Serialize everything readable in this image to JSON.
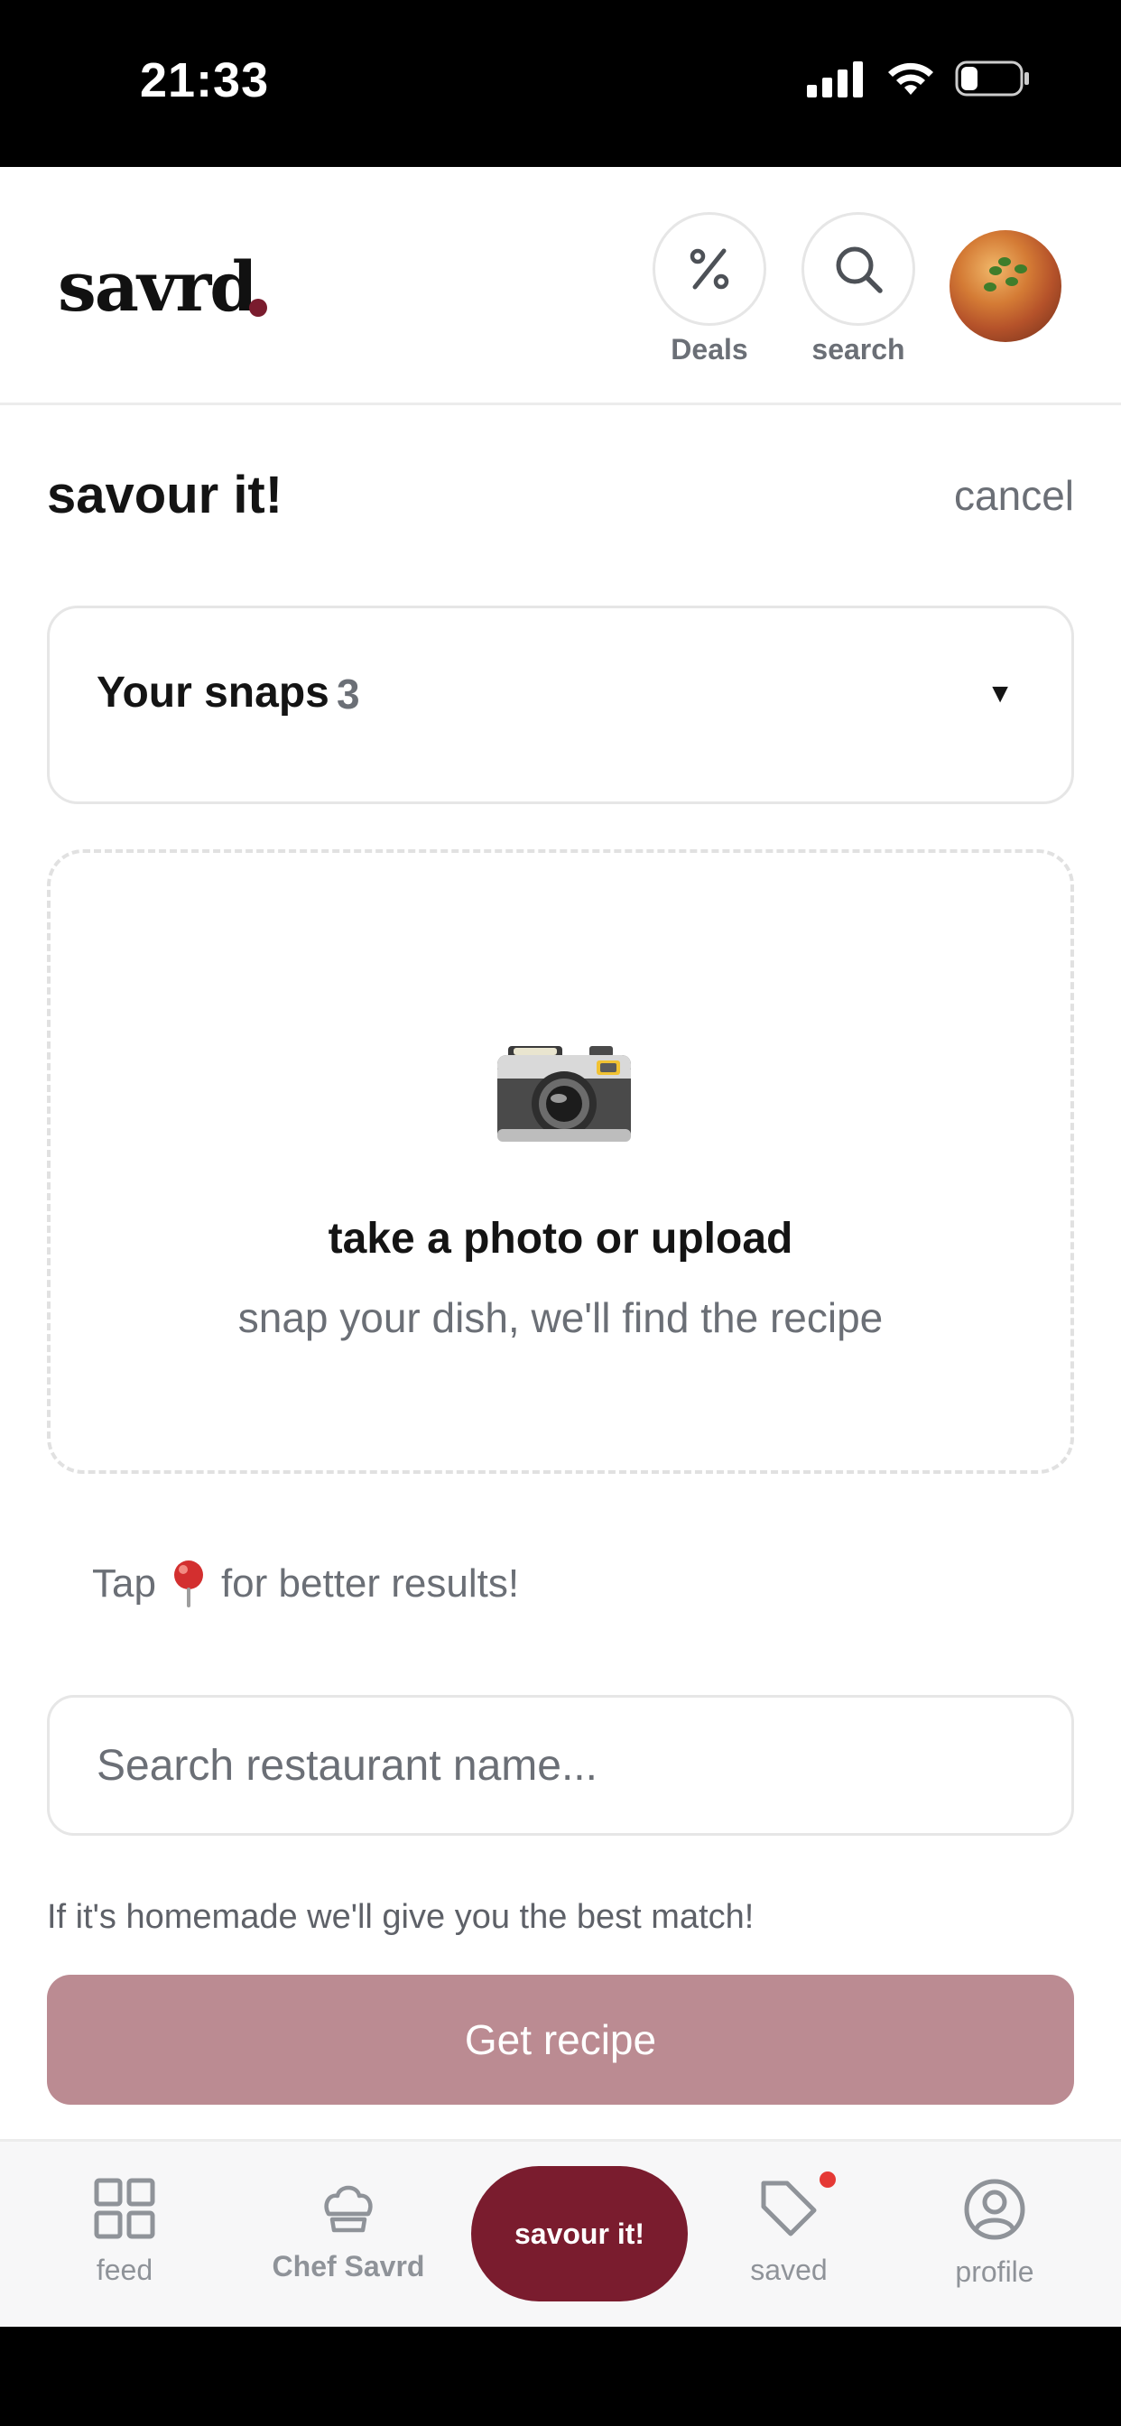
{
  "status_bar": {
    "time": "21:33"
  },
  "header": {
    "logo": "savrd",
    "deals_label": "Deals",
    "search_label": "search"
  },
  "page": {
    "title": "savour it!",
    "cancel_label": "cancel"
  },
  "snaps": {
    "label": "Your snaps",
    "count": "3",
    "caret": "▼"
  },
  "upload": {
    "title": "take a photo or upload",
    "subtitle": "snap your dish, we'll find the recipe"
  },
  "tip": {
    "before": "Tap",
    "after": "for better results!"
  },
  "restaurant_search": {
    "placeholder": "Search restaurant name..."
  },
  "homemade_note": "If it's homemade we'll give you the best match!",
  "get_recipe_label": "Get recipe",
  "bottom_nav": {
    "feed": "feed",
    "chef": "Chef Savrd",
    "savour": "savour it!",
    "saved": "saved",
    "profile": "profile"
  },
  "colors": {
    "brand": "#7a1c2e",
    "button_disabled": "#bb8b92",
    "muted_text": "#6b6f76",
    "notification": "#e53935"
  }
}
